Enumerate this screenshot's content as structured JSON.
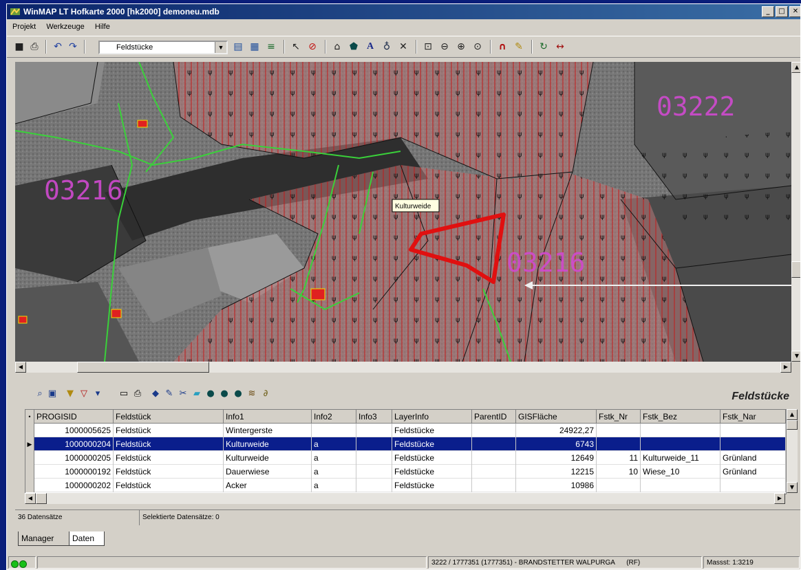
{
  "window": {
    "title": "WinMAP LT Hofkarte 2000 [hk2000] demoneu.mdb",
    "min_glyph": "_",
    "max_glyph": "□",
    "close_glyph": "✕"
  },
  "menu": [
    "Projekt",
    "Werkzeuge",
    "Hilfe"
  ],
  "toolbar": {
    "layer_select_value": "Feldstücke",
    "layer_select_arrow": "▼",
    "icons": [
      {
        "name": "save-icon",
        "glyph": "■"
      },
      {
        "name": "print-icon",
        "glyph": "⎙"
      },
      {
        "name": "undo-icon",
        "glyph": "↶"
      },
      {
        "name": "redo-icon",
        "glyph": "↷"
      },
      {
        "name": "layer-properties-icon",
        "glyph": "▤"
      },
      {
        "name": "layer-edit-icon",
        "glyph": "▦"
      },
      {
        "name": "layer-stack-icon",
        "glyph": "≡"
      },
      {
        "name": "select-arrow-icon",
        "glyph": "↖"
      },
      {
        "name": "no-select-icon",
        "glyph": "⊘"
      },
      {
        "name": "polygon-icon",
        "glyph": "⌂"
      },
      {
        "name": "fill-shape-icon",
        "glyph": "⬟"
      },
      {
        "name": "text-tool-icon",
        "glyph": "A"
      },
      {
        "name": "point-marker-icon",
        "glyph": "♁"
      },
      {
        "name": "delete-icon",
        "glyph": "✕"
      },
      {
        "name": "zoom-extent-icon",
        "glyph": "⊡"
      },
      {
        "name": "zoom-out-icon",
        "glyph": "⊖"
      },
      {
        "name": "zoom-in-icon",
        "glyph": "⊕"
      },
      {
        "name": "zoom-window-icon",
        "glyph": "⊙"
      },
      {
        "name": "magnet-icon",
        "glyph": "∩"
      },
      {
        "name": "ruler-icon",
        "glyph": "✎"
      },
      {
        "name": "refresh-icon",
        "glyph": "↻"
      },
      {
        "name": "measure-line-icon",
        "glyph": "↔"
      }
    ]
  },
  "map": {
    "parcel_labels": [
      "03222",
      "03216",
      "03216"
    ],
    "tooltip": "Kulturweide"
  },
  "data_panel": {
    "title": "Feldstücke",
    "tools": [
      {
        "name": "find-record-icon",
        "glyph": "⌕"
      },
      {
        "name": "form-view-icon",
        "glyph": "▣"
      },
      {
        "name": "filter-icon",
        "glyph": "▼"
      },
      {
        "name": "filter-remove-icon",
        "glyph": "▽"
      },
      {
        "name": "filter-selection-icon",
        "glyph": "▾"
      },
      {
        "name": "table-view-icon",
        "glyph": "▭"
      },
      {
        "name": "print-table-icon",
        "glyph": "⎙"
      },
      {
        "name": "locate-icon",
        "glyph": "◆"
      },
      {
        "name": "edit-record-icon",
        "glyph": "✎"
      },
      {
        "name": "cut-icon",
        "glyph": "✂"
      },
      {
        "name": "export-icon",
        "glyph": "▰"
      },
      {
        "name": "highlight-1-icon",
        "glyph": "●"
      },
      {
        "name": "highlight-2-icon",
        "glyph": "●"
      },
      {
        "name": "highlight-3-icon",
        "glyph": "●"
      },
      {
        "name": "tools-icon",
        "glyph": "≋"
      },
      {
        "name": "attach-icon",
        "glyph": "∂"
      }
    ],
    "columns": [
      "PROGISID",
      "Feldstück",
      "Info1",
      "Info2",
      "Info3",
      "LayerInfo",
      "ParentID",
      "GISFläche",
      "Fstk_Nr",
      "Fstk_Bez",
      "Fstk_Nar"
    ],
    "rows": [
      [
        "1000005625",
        "Feldstück",
        "Wintergerste",
        "",
        "",
        "Feldstücke",
        "",
        "24922,27",
        "",
        "",
        ""
      ],
      [
        "1000000204",
        "Feldstück",
        "Kulturweide",
        "a",
        "",
        "Feldstücke",
        "",
        "6743",
        "",
        "",
        ""
      ],
      [
        "1000000205",
        "Feldstück",
        "Kulturweide",
        "a",
        "",
        "Feldstücke",
        "",
        "12649",
        "11",
        "Kulturweide_11",
        "Grünland"
      ],
      [
        "1000000192",
        "Feldstück",
        "Dauerwiese",
        "a",
        "",
        "Feldstücke",
        "",
        "12215",
        "10",
        "Wiese_10",
        "Grünland"
      ],
      [
        "1000000202",
        "Feldstück",
        "Acker",
        "a",
        "",
        "Feldstücke",
        "",
        "10986",
        "",
        "",
        ""
      ]
    ],
    "selected_row": 1,
    "head_marker": "•",
    "row_marker": "▶",
    "record_count": "36 Datensätze",
    "selected_count": "Selektierte Datensätze: 0"
  },
  "tabs": [
    "Manager",
    "Daten"
  ],
  "active_tab": "Daten",
  "statusbar": {
    "owner": "3222 / 1777351 (1777351) - BRANDSTETTER WALPURGA",
    "flag": "(RF)",
    "scale": "Massst: 1:3219"
  }
}
